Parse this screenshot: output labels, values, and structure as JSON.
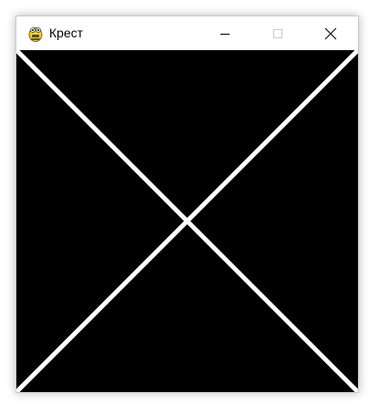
{
  "window": {
    "title": "Крест",
    "controls": [
      "minimize-button",
      "maximize-button",
      "close-button"
    ]
  },
  "canvas": {
    "background": "#000000",
    "line_color": "#ffffff",
    "shapes": [
      "diagonal-line-1",
      "diagonal-line-2"
    ]
  },
  "colors": {
    "titlebar": "#ffffff",
    "icon_yellow": "#f2cf2a"
  }
}
